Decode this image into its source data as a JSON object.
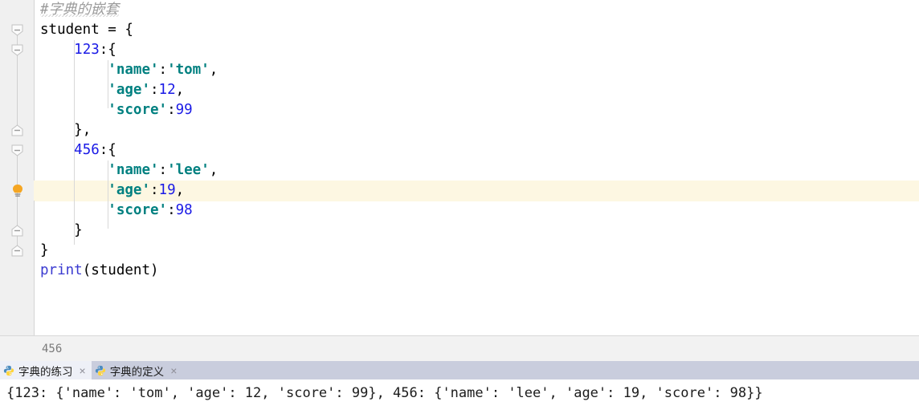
{
  "editor": {
    "lines": [
      {
        "indent": 0,
        "tokens": [
          {
            "t": "comment",
            "v": "#字典的嵌套"
          }
        ]
      },
      {
        "indent": 0,
        "tokens": [
          {
            "t": "plain",
            "v": "student = {"
          }
        ]
      },
      {
        "indent": 1,
        "tokens": [
          {
            "t": "num",
            "v": "123"
          },
          {
            "t": "plain",
            "v": ":{"
          }
        ]
      },
      {
        "indent": 2,
        "tokens": [
          {
            "t": "str",
            "v": "'name'"
          },
          {
            "t": "plain",
            "v": ":"
          },
          {
            "t": "str",
            "v": "'tom'"
          },
          {
            "t": "plain",
            "v": ","
          }
        ]
      },
      {
        "indent": 2,
        "tokens": [
          {
            "t": "str",
            "v": "'age'"
          },
          {
            "t": "plain",
            "v": ":"
          },
          {
            "t": "num",
            "v": "12"
          },
          {
            "t": "plain",
            "v": ","
          }
        ]
      },
      {
        "indent": 2,
        "tokens": [
          {
            "t": "str",
            "v": "'score'"
          },
          {
            "t": "plain",
            "v": ":"
          },
          {
            "t": "num",
            "v": "99"
          }
        ]
      },
      {
        "indent": 1,
        "tokens": [
          {
            "t": "plain",
            "v": "},"
          }
        ]
      },
      {
        "indent": 1,
        "tokens": [
          {
            "t": "num",
            "v": "456"
          },
          {
            "t": "plain",
            "v": ":{"
          }
        ]
      },
      {
        "indent": 2,
        "tokens": [
          {
            "t": "str",
            "v": "'name'"
          },
          {
            "t": "plain",
            "v": ":"
          },
          {
            "t": "str",
            "v": "'lee'"
          },
          {
            "t": "plain",
            "v": ","
          }
        ]
      },
      {
        "indent": 2,
        "highlighted": true,
        "tokens": [
          {
            "t": "str",
            "v": "'age'"
          },
          {
            "t": "plain",
            "v": ":"
          },
          {
            "t": "num",
            "v": "19"
          },
          {
            "t": "plain",
            "v": ","
          }
        ]
      },
      {
        "indent": 2,
        "tokens": [
          {
            "t": "str",
            "v": "'score'"
          },
          {
            "t": "plain",
            "v": ":"
          },
          {
            "t": "num",
            "v": "98"
          }
        ]
      },
      {
        "indent": 1,
        "tokens": [
          {
            "t": "plain",
            "v": "}"
          }
        ]
      },
      {
        "indent": 0,
        "tokens": [
          {
            "t": "plain",
            "v": "}"
          }
        ]
      },
      {
        "indent": 0,
        "tokens": [
          {
            "t": "builtin",
            "v": "print"
          },
          {
            "t": "plain",
            "v": "(student)"
          }
        ]
      }
    ],
    "gutter": {
      "fold_markers": [
        {
          "line": 1,
          "state": "expanded-open"
        },
        {
          "line": 2,
          "state": "expanded-open"
        },
        {
          "line": 6,
          "state": "expanded-close"
        },
        {
          "line": 7,
          "state": "expanded-open"
        },
        {
          "line": 11,
          "state": "expanded-close"
        },
        {
          "line": 12,
          "state": "expanded-close"
        }
      ],
      "intention_bulb": {
        "line": 9,
        "icon": "lightbulb-icon"
      }
    }
  },
  "breadcrumb": {
    "text": "456"
  },
  "tabs": [
    {
      "label": "字典的练习",
      "icon": "python-file-icon",
      "active": true,
      "close": "×"
    },
    {
      "label": "字典的定义",
      "icon": "python-file-icon",
      "active": false,
      "close": "×"
    }
  ],
  "console": {
    "output": "{123: {'name': 'tom', 'age': 12, 'score': 99}, 456: {'name': 'lee', 'age': 19, 'score': 98}}"
  },
  "colors": {
    "string": "#008080",
    "number": "#1a1ae6",
    "builtin": "#3a3ad0",
    "comment": "#9b9b9b",
    "highlight_line": "#fdf7e2",
    "gutter_bg": "#f0f0f0",
    "tabbar_bg": "#c9cddd",
    "active_tab_bg": "#eef0f7",
    "bulb": "#f5a623"
  }
}
